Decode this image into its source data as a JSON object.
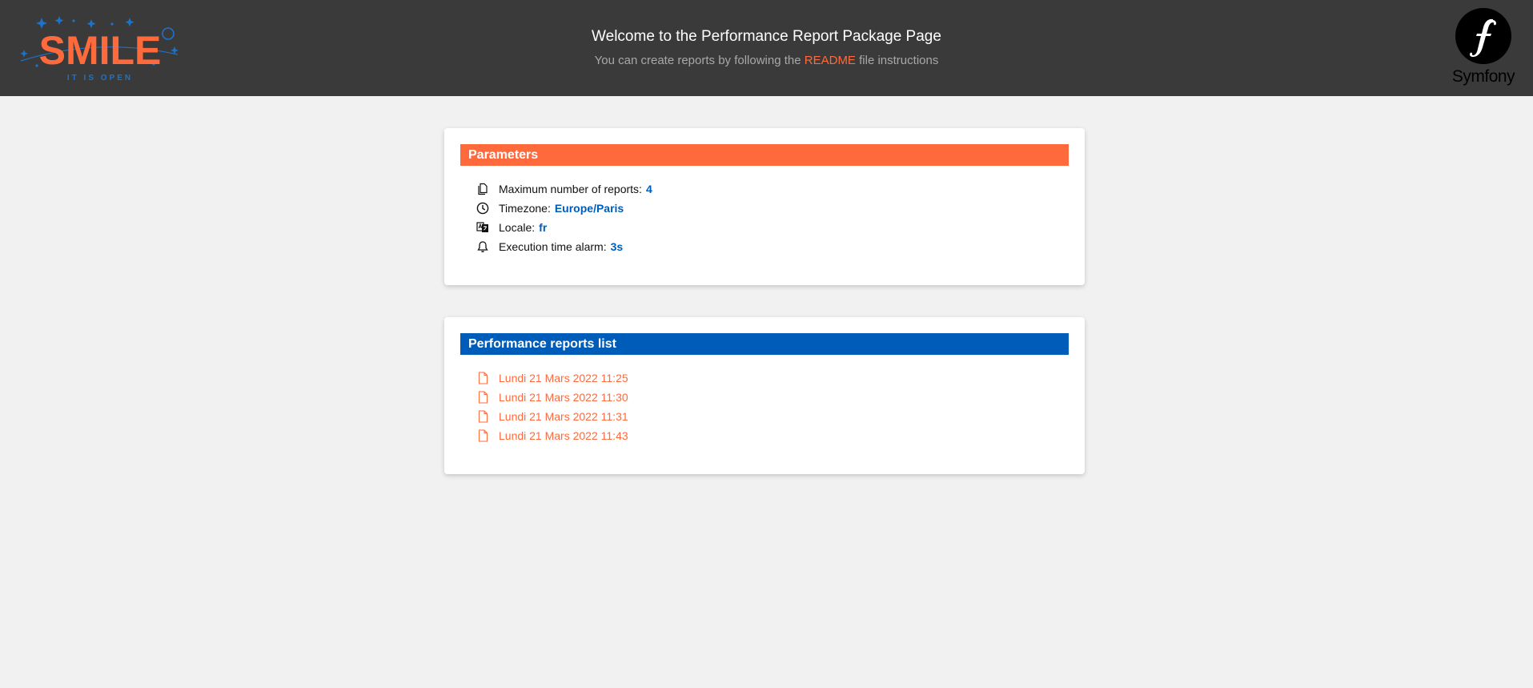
{
  "header": {
    "logo_text": "SMILE",
    "logo_tagline": "IT IS OPEN",
    "title": "Welcome to the Performance Report Package Page",
    "subtitle_prefix": "You can create reports by following the",
    "subtitle_link": "README",
    "subtitle_suffix": "file instructions",
    "symfony_label": "Symfony"
  },
  "parameters": {
    "heading": "Parameters",
    "items": [
      {
        "icon": "files-icon",
        "label": "Maximum number of reports:",
        "value": "4"
      },
      {
        "icon": "clock-icon",
        "label": "Timezone:",
        "value": "Europe/Paris"
      },
      {
        "icon": "translate-icon",
        "label": "Locale:",
        "value": "fr"
      },
      {
        "icon": "bell-icon",
        "label": "Execution time alarm:",
        "value": "3s"
      }
    ]
  },
  "reports": {
    "heading": "Performance reports list",
    "items": [
      {
        "icon": "file-icon",
        "label": "Lundi 21 Mars 2022 11:25"
      },
      {
        "icon": "file-icon",
        "label": "Lundi 21 Mars 2022 11:30"
      },
      {
        "icon": "file-icon",
        "label": "Lundi 21 Mars 2022 11:31"
      },
      {
        "icon": "file-icon",
        "label": "Lundi 21 Mars 2022 11:43"
      }
    ]
  },
  "colors": {
    "accent_orange": "#ff6a3d",
    "accent_blue": "#005cb9",
    "header_bg": "#3a3a3a",
    "page_bg": "#f1f1f1"
  }
}
